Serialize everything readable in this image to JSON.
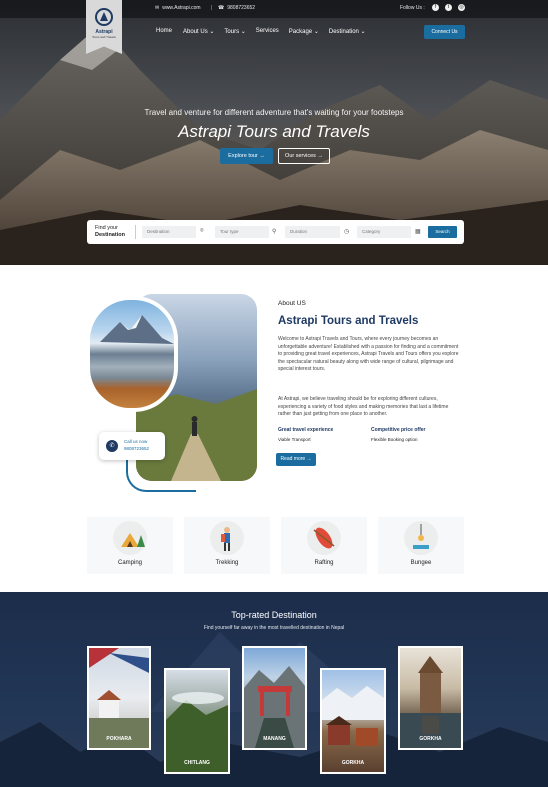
{
  "topbar": {
    "email": "www.Astrapi.com",
    "separator": "|",
    "phone": "9808723652",
    "follow": "Follow Us :",
    "social": [
      "facebook-icon",
      "twitter-icon",
      "instagram-icon"
    ]
  },
  "brand": {
    "name": "Astrapi",
    "tagline": "Tours and Travels"
  },
  "nav": {
    "items": [
      "Home",
      "About Us",
      "Tours",
      "Services",
      "Package",
      "Destination"
    ],
    "connect_label": "Connect Us"
  },
  "hero": {
    "subtitle": "Travel and venture for different adventure that's waiting for your footsteps",
    "title": "Astrapi Tours and Travels",
    "explore_label": "Explore tour →",
    "services_label": "Our services →"
  },
  "search": {
    "label_1": "Find your",
    "label_2": "Destination",
    "fields": [
      "Destination",
      "Tour type",
      "Duration",
      "Category"
    ],
    "button": "Search"
  },
  "about": {
    "label": "About US",
    "title": "Astrapi Tours and Travels",
    "paragraph_1": "Welcome to Astrapi Travels and Tours, where every journey becomes an unforgettable adventure! Established with a passion for finding and a commitment to providing great travel experiences, Astrapi Travels and Tours offers you explore the spectacular natural beauty along with wide range of cultural, pilgrimage and special interest tours.",
    "paragraph_2": "At Astrapi, we believe traveling should be for exploring different cultures, experiencing a variety of food styles and making memories that last a lifetime rather than just getting from one place to another.",
    "feature_1_title": "Great travel experience",
    "feature_2_title": "Competitive price offer",
    "feature_1_text": "Viable Transport",
    "feature_2_text": "Flexible Booking option",
    "read_more": "Read more →",
    "call_label": "Call us now",
    "call_number": "9808723652"
  },
  "activities": [
    "Camping",
    "Trekking",
    "Rafting",
    "Bungee"
  ],
  "destinations": {
    "title": "Top-rated Destination",
    "subtitle": "Find yourself far away in the most travelled destination in Nepal",
    "cards": [
      "POKHARA",
      "CHITLANG",
      "MANANG",
      "GORKHA",
      "GORKHA"
    ]
  },
  "colors": {
    "accent": "#1b6da0",
    "navy": "#1f3a63"
  }
}
